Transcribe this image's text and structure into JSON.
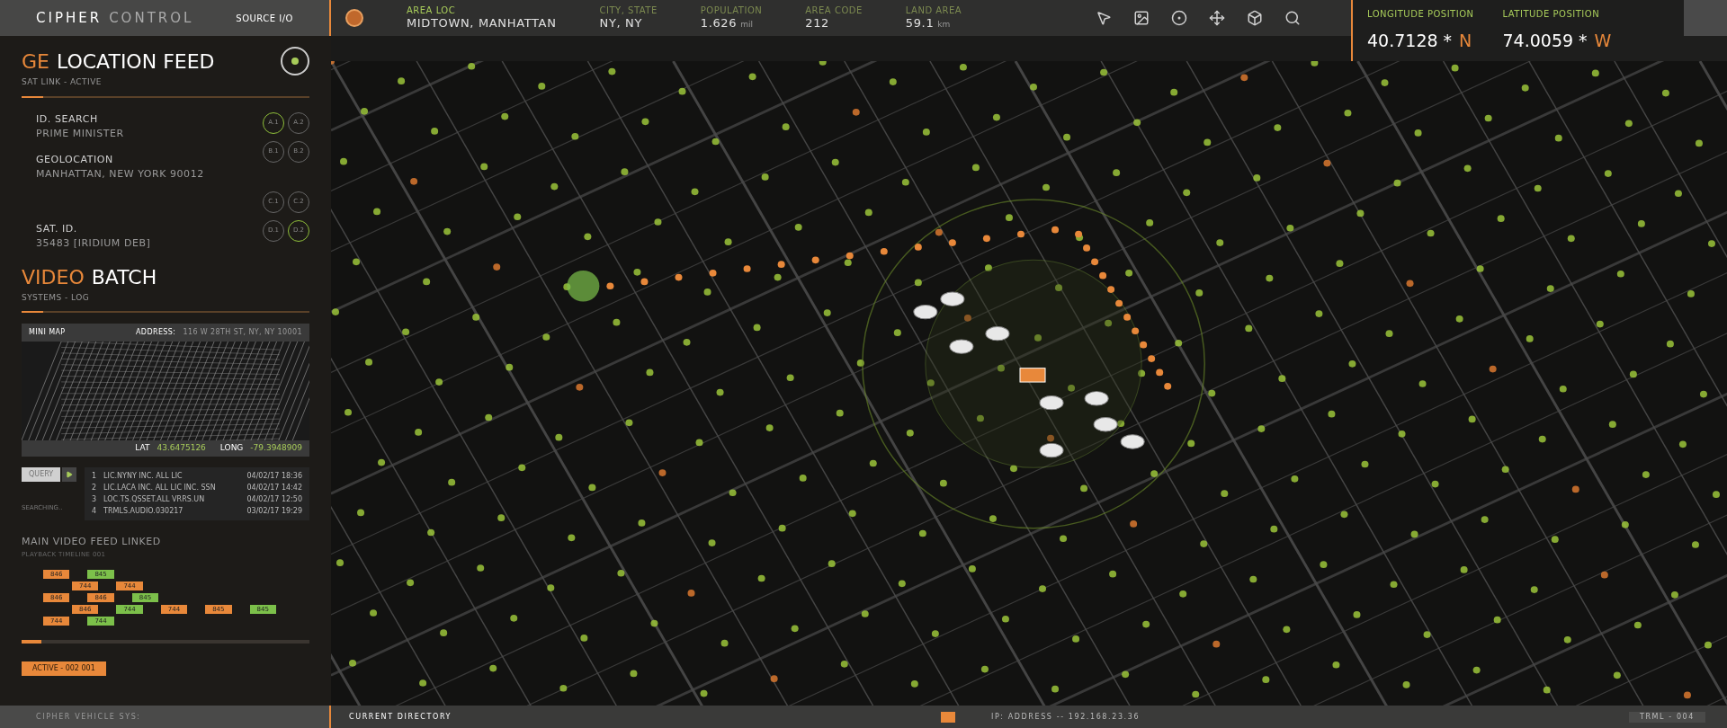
{
  "top_bar": {
    "title_a": "CIPHER",
    "title_b": "CONTROL",
    "source": "SOURCE I/O",
    "stats": [
      {
        "label": "AREA LOC",
        "value": "MIDTOWN, MANHATTAN"
      },
      {
        "label": "CITY, STATE",
        "value": "NY, NY"
      },
      {
        "label": "POPULATION",
        "value": "1.626",
        "unit": "mil"
      },
      {
        "label": "AREA CODE",
        "value": "212"
      },
      {
        "label": "LAND AREA",
        "value": "59.1",
        "unit": "km"
      }
    ],
    "tools": [
      {
        "kind": "pointer"
      },
      {
        "kind": "image"
      },
      {
        "kind": "target"
      },
      {
        "kind": "move"
      },
      {
        "kind": "cube"
      },
      {
        "kind": "search"
      }
    ],
    "positions": [
      {
        "label": "LONGITUDE POSITION",
        "value": "40.7128 *",
        "dir": "N"
      },
      {
        "label": "LATITUDE POSITION",
        "value": "74.0059 *",
        "dir": "W"
      }
    ]
  },
  "location_feed": {
    "title_a": "GE",
    "title_b": "LOCATION FEED",
    "subtitle": "SAT LINK - ACTIVE",
    "fields": [
      {
        "label": "ID. SEARCH",
        "value": "PRIME MINISTER"
      },
      {
        "label": "GEOLOCATION",
        "value": "MANHATTAN, NEW YORK 90012"
      },
      {
        "label": "SAT. ID.",
        "value": "35483 [IRIDIUM DEB]"
      }
    ],
    "channels": [
      {
        "label": "A.1",
        "selected": true
      },
      {
        "label": "A.2",
        "selected": false
      },
      {
        "label": "B.1",
        "selected": false
      },
      {
        "label": "B.2",
        "selected": false
      },
      {
        "label": "C.1",
        "selected": false
      },
      {
        "label": "C.2",
        "selected": false
      },
      {
        "label": "D.1",
        "selected": false
      },
      {
        "label": "D.2",
        "selected": true
      }
    ]
  },
  "video_batch": {
    "title_a": "VIDEO",
    "title_b": "BATCH",
    "subtitle": "SYSTEMS - LOG"
  },
  "mini_map": {
    "title": "MINI MAP",
    "address_label": "ADDRESS:",
    "address": "116 W 28TH ST, NY, NY 10001",
    "lat_label": "LAT",
    "lat": "43.6475126",
    "long_label": "LONG",
    "long": "-79.3948909"
  },
  "query": {
    "button": "QUERY",
    "status": "SEARCHING..",
    "results": [
      {
        "index": "1",
        "name": "LIC.NYNY INC. ALL LIC",
        "time": "04/02/17 18:36"
      },
      {
        "index": "2",
        "name": "LIC.LACA INC. ALL LIC INC. SSN",
        "time": "04/02/17 14:42"
      },
      {
        "index": "3",
        "name": "LOC.TS.QSSET.ALL VRRS.UN",
        "time": "04/02/17 12:50"
      },
      {
        "index": "4",
        "name": "TRMLS.AUDIO.030217",
        "time": "03/02/17 19:29"
      }
    ]
  },
  "video_feed": {
    "title": "MAIN VIDEO FEED LINKED",
    "subtitle": "PLAYBACK TIMELINE 001",
    "rows": [
      [
        {
          "label": "846",
          "color": "#e8883a"
        },
        {
          "label": "845",
          "color": "#7cc04a"
        }
      ],
      [
        {
          "label": "744",
          "color": "#e8883a"
        },
        {
          "label": "744",
          "color": "#e8883a"
        }
      ],
      [
        {
          "label": "846",
          "color": "#e8883a"
        },
        {
          "label": "846",
          "color": "#e8883a"
        },
        {
          "label": "845",
          "color": "#7cc04a"
        }
      ],
      [
        {
          "label": "846",
          "color": "#e8883a"
        },
        {
          "label": "744",
          "color": "#7cc04a"
        },
        {
          "label": "744",
          "color": "#e8883a"
        },
        {
          "label": "845",
          "color": "#e8883a"
        },
        {
          "label": "845",
          "color": "#7cc04a"
        }
      ],
      [
        {
          "label": "744",
          "color": "#e8883a"
        },
        {
          "label": "744",
          "color": "#7cc04a"
        }
      ]
    ],
    "progress": {
      "level": 0.07
    },
    "active": "ACTIVE - 002 001"
  },
  "bottom_bar": {
    "system": "CIPHER VEHICLE SYS:",
    "directory": "CURRENT DIRECTORY",
    "ip": "IP: ADDRESS -- 192.168.23.36",
    "terminal": "TRML - 004"
  }
}
